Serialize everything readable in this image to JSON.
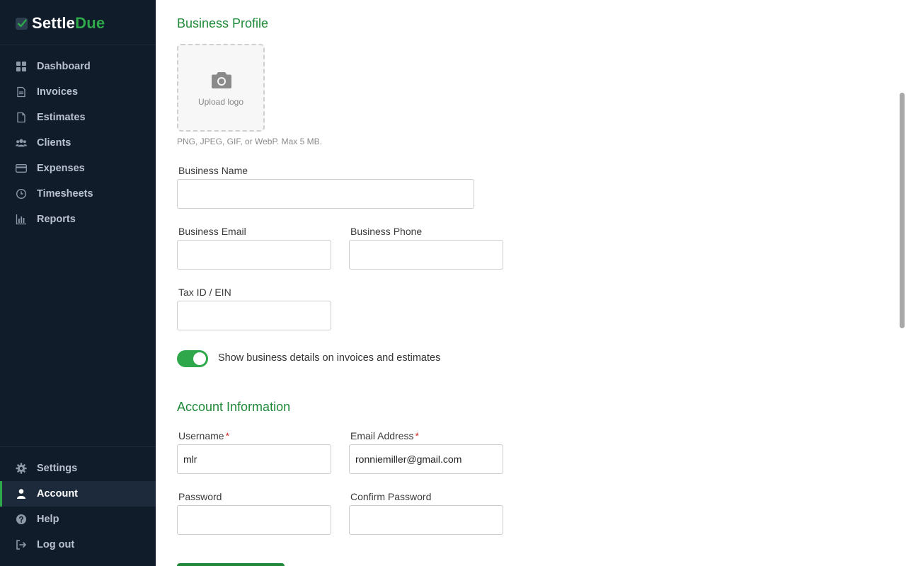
{
  "app": {
    "logo_part1": "Settle",
    "logo_part2": "Due"
  },
  "sidebar": {
    "main_items": [
      {
        "label": "Dashboard",
        "icon": "dashboard-icon"
      },
      {
        "label": "Invoices",
        "icon": "invoice-icon"
      },
      {
        "label": "Estimates",
        "icon": "estimate-icon"
      },
      {
        "label": "Clients",
        "icon": "clients-icon"
      },
      {
        "label": "Expenses",
        "icon": "credit-card-icon"
      },
      {
        "label": "Timesheets",
        "icon": "clock-icon"
      },
      {
        "label": "Reports",
        "icon": "bar-chart-icon"
      }
    ],
    "bottom_items": [
      {
        "label": "Settings",
        "icon": "gear-icon"
      },
      {
        "label": "Account",
        "icon": "user-icon",
        "active": true
      },
      {
        "label": "Help",
        "icon": "help-icon"
      },
      {
        "label": "Log out",
        "icon": "logout-icon"
      }
    ]
  },
  "business_profile": {
    "title": "Business Profile",
    "upload_label": "Upload logo",
    "upload_hint": "PNG, JPEG, GIF, or WebP. Max 5 MB.",
    "business_name_label": "Business Name",
    "business_name_value": "",
    "business_email_label": "Business Email",
    "business_email_value": "",
    "business_phone_label": "Business Phone",
    "business_phone_value": "",
    "tax_id_label": "Tax ID / EIN",
    "tax_id_value": "",
    "show_details_label": "Show business details on invoices and estimates",
    "show_details_on": true
  },
  "account_info": {
    "title": "Account Information",
    "username_label": "Username",
    "username_value": "mlr",
    "email_label": "Email Address",
    "email_value": "ronniemiller@gmail.com",
    "required_mark": "*",
    "password_label": "Password",
    "password_value": "",
    "confirm_password_label": "Confirm Password",
    "confirm_password_value": ""
  },
  "colors": {
    "accent": "#2ea84a",
    "sidebar_bg": "#111c2b",
    "heading": "#1e8a3a",
    "required": "#d02b2b"
  }
}
